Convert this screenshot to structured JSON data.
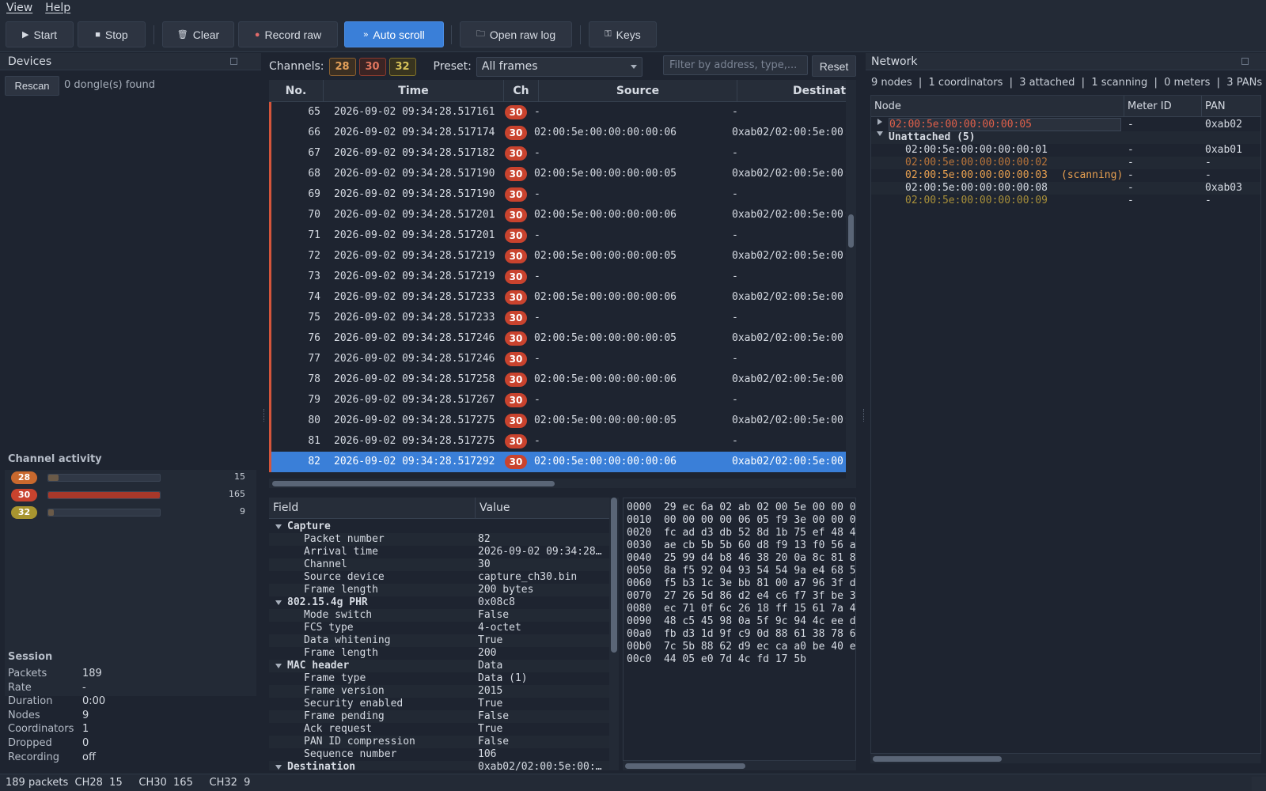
{
  "menu": [
    "View",
    "Help"
  ],
  "toolbar": {
    "start": "Start",
    "stop": "Stop",
    "clear": "Clear",
    "record_raw": "Record raw",
    "auto_scroll": "Auto scroll",
    "open_raw_log": "Open raw log",
    "keys": "Keys"
  },
  "devices": {
    "title": "Devices",
    "rescan": "Rescan",
    "status": "0 dongle(s) found"
  },
  "channel_activity": {
    "title": "Channel activity",
    "channels": [
      {
        "ch": "28",
        "count": "15",
        "fraction": 0.09,
        "color": "#c9692e"
      },
      {
        "ch": "30",
        "count": "165",
        "fraction": 1.0,
        "color": "#c9432e"
      },
      {
        "ch": "32",
        "count": "9",
        "fraction": 0.05,
        "color": "#a89530"
      }
    ]
  },
  "session": {
    "title": "Session",
    "rows": [
      {
        "k": "Packets",
        "v": "189"
      },
      {
        "k": "Rate",
        "v": "-"
      },
      {
        "k": "Duration",
        "v": "0:00"
      },
      {
        "k": "Nodes",
        "v": "9"
      },
      {
        "k": "Coordinators",
        "v": "1"
      },
      {
        "k": "Dropped",
        "v": "0"
      },
      {
        "k": "Recording",
        "v": "off"
      }
    ]
  },
  "filterbar": {
    "channels_label": "Channels:",
    "chips": [
      {
        "ch": "28",
        "color": "#e3a05a",
        "bg": "#3b2f22",
        "border": "#8a6030"
      },
      {
        "ch": "30",
        "color": "#e0765e",
        "bg": "#3b2424",
        "border": "#8a3a2e"
      },
      {
        "ch": "32",
        "color": "#d8c35a",
        "bg": "#38341f",
        "border": "#80712a"
      }
    ],
    "preset_label": "Preset:",
    "preset_value": "All frames",
    "filter_placeholder": "Filter by address, type,...",
    "reset": "Reset"
  },
  "packet_table": {
    "columns": [
      "No.",
      "Time",
      "Ch",
      "Source",
      "Destinati"
    ],
    "rows": [
      {
        "no": "65",
        "time": "2026-09-02 09:34:28.517161",
        "ch": "30",
        "src": "-",
        "dst": "-"
      },
      {
        "no": "66",
        "time": "2026-09-02 09:34:28.517174",
        "ch": "30",
        "src": "02:00:5e:00:00:00:00:06",
        "dst": "0xab02/02:00:5e:00:"
      },
      {
        "no": "67",
        "time": "2026-09-02 09:34:28.517182",
        "ch": "30",
        "src": "-",
        "dst": "-"
      },
      {
        "no": "68",
        "time": "2026-09-02 09:34:28.517190",
        "ch": "30",
        "src": "02:00:5e:00:00:00:00:05",
        "dst": "0xab02/02:00:5e:00:"
      },
      {
        "no": "69",
        "time": "2026-09-02 09:34:28.517190",
        "ch": "30",
        "src": "-",
        "dst": "-"
      },
      {
        "no": "70",
        "time": "2026-09-02 09:34:28.517201",
        "ch": "30",
        "src": "02:00:5e:00:00:00:00:06",
        "dst": "0xab02/02:00:5e:00:"
      },
      {
        "no": "71",
        "time": "2026-09-02 09:34:28.517201",
        "ch": "30",
        "src": "-",
        "dst": "-"
      },
      {
        "no": "72",
        "time": "2026-09-02 09:34:28.517219",
        "ch": "30",
        "src": "02:00:5e:00:00:00:00:05",
        "dst": "0xab02/02:00:5e:00:"
      },
      {
        "no": "73",
        "time": "2026-09-02 09:34:28.517219",
        "ch": "30",
        "src": "-",
        "dst": "-"
      },
      {
        "no": "74",
        "time": "2026-09-02 09:34:28.517233",
        "ch": "30",
        "src": "02:00:5e:00:00:00:00:06",
        "dst": "0xab02/02:00:5e:00:"
      },
      {
        "no": "75",
        "time": "2026-09-02 09:34:28.517233",
        "ch": "30",
        "src": "-",
        "dst": "-"
      },
      {
        "no": "76",
        "time": "2026-09-02 09:34:28.517246",
        "ch": "30",
        "src": "02:00:5e:00:00:00:00:05",
        "dst": "0xab02/02:00:5e:00:"
      },
      {
        "no": "77",
        "time": "2026-09-02 09:34:28.517246",
        "ch": "30",
        "src": "-",
        "dst": "-"
      },
      {
        "no": "78",
        "time": "2026-09-02 09:34:28.517258",
        "ch": "30",
        "src": "02:00:5e:00:00:00:00:06",
        "dst": "0xab02/02:00:5e:00:"
      },
      {
        "no": "79",
        "time": "2026-09-02 09:34:28.517267",
        "ch": "30",
        "src": "-",
        "dst": "-"
      },
      {
        "no": "80",
        "time": "2026-09-02 09:34:28.517275",
        "ch": "30",
        "src": "02:00:5e:00:00:00:00:05",
        "dst": "0xab02/02:00:5e:00:"
      },
      {
        "no": "81",
        "time": "2026-09-02 09:34:28.517275",
        "ch": "30",
        "src": "-",
        "dst": "-"
      },
      {
        "no": "82",
        "time": "2026-09-02 09:34:28.517292",
        "ch": "30",
        "src": "02:00:5e:00:00:00:00:06",
        "dst": "0xab02/02:00:5e:00:",
        "selected": true
      }
    ]
  },
  "detail": {
    "columns": [
      "Field",
      "Value"
    ],
    "rows": [
      {
        "type": "grp",
        "f": "Capture",
        "v": ""
      },
      {
        "type": "leaf",
        "f": "Packet number",
        "v": "82"
      },
      {
        "type": "leaf",
        "f": "Arrival time",
        "v": "2026-09-02 09:34:28..."
      },
      {
        "type": "leaf",
        "f": "Channel",
        "v": "30"
      },
      {
        "type": "leaf",
        "f": "Source device",
        "v": "capture_ch30.bin"
      },
      {
        "type": "leaf",
        "f": "Frame length",
        "v": "200 bytes"
      },
      {
        "type": "grp",
        "f": "802.15.4g PHR",
        "v": "0x08c8"
      },
      {
        "type": "leaf",
        "f": "Mode switch",
        "v": "False"
      },
      {
        "type": "leaf",
        "f": "FCS type",
        "v": "4-octet"
      },
      {
        "type": "leaf",
        "f": "Data whitening",
        "v": "True"
      },
      {
        "type": "leaf",
        "f": "Frame length",
        "v": "200"
      },
      {
        "type": "grp",
        "f": "MAC header",
        "v": "Data"
      },
      {
        "type": "leaf",
        "f": "Frame type",
        "v": "Data (1)"
      },
      {
        "type": "leaf",
        "f": "Frame version",
        "v": "2015"
      },
      {
        "type": "leaf",
        "f": "Security enabled",
        "v": "True"
      },
      {
        "type": "leaf",
        "f": "Frame pending",
        "v": "False"
      },
      {
        "type": "leaf",
        "f": "Ack request",
        "v": "True"
      },
      {
        "type": "leaf",
        "f": "PAN ID compression",
        "v": "False"
      },
      {
        "type": "leaf",
        "f": "Sequence number",
        "v": "106"
      },
      {
        "type": "grp",
        "f": "Destination",
        "v": "0xab02/02:00:5e:00:..."
      }
    ]
  },
  "hex": [
    "0000  29 ec 6a 02 ab 02 00 5e 00 00 0",
    "0010  00 00 00 00 06 05 f9 3e 00 00 0",
    "0020  fc ad d3 db 52 8d 1b 75 ef 48 4",
    "0030  ae cb 5b 5b 60 d8 f9 13 f0 56 a",
    "0040  25 99 d4 b8 46 38 20 0a 8c 81 8",
    "0050  8a f5 92 04 93 54 54 9a e4 68 5",
    "0060  f5 b3 1c 3e bb 81 00 a7 96 3f d",
    "0070  27 26 5d 86 d2 e4 c6 f7 3f be 3",
    "0080  ec 71 0f 6c 26 18 ff 15 61 7a 4",
    "0090  48 c5 45 98 0a 5f 9c 94 4c ee d",
    "00a0  fb d3 1d 9f c9 0d 88 61 38 78 6",
    "00b0  7c 5b 88 62 d9 ec ca a0 be 40 e",
    "00c0  44 05 e0 7d 4c fd 17 5b"
  ],
  "network": {
    "title": "Network",
    "summary": "9 nodes  |  1 coordinators  |  3 attached  |  1 scanning  |  0 meters  |  3 PANs",
    "columns": [
      "Node",
      "Meter ID",
      "PAN"
    ],
    "rows": [
      {
        "kind": "coord",
        "node": "02:00:5e:00:00:00:00:05",
        "meter": "-",
        "pan": "0xab02",
        "color": "#e0604a"
      },
      {
        "kind": "group",
        "node": "Unattached (5)",
        "meter": "",
        "pan": ""
      },
      {
        "kind": "child",
        "node": "02:00:5e:00:00:00:00:01",
        "meter": "-",
        "pan": "0xab01",
        "color": "#d6dbe3"
      },
      {
        "kind": "child",
        "node": "02:00:5e:00:00:00:00:02",
        "meter": "-",
        "pan": "-",
        "color": "#b8743a"
      },
      {
        "kind": "child",
        "node": "02:00:5e:00:00:00:00:03",
        "extra": "(scanning)",
        "meter": "-",
        "pan": "-",
        "color": "#e8a050"
      },
      {
        "kind": "child",
        "node": "02:00:5e:00:00:00:00:08",
        "meter": "-",
        "pan": "0xab03",
        "color": "#d6dbe3"
      },
      {
        "kind": "child",
        "node": "02:00:5e:00:00:00:00:09",
        "meter": "-",
        "pan": "-",
        "color": "#a8903a"
      }
    ]
  },
  "statusbar": "189 packets  CH28  15     CH30  165     CH32  9"
}
